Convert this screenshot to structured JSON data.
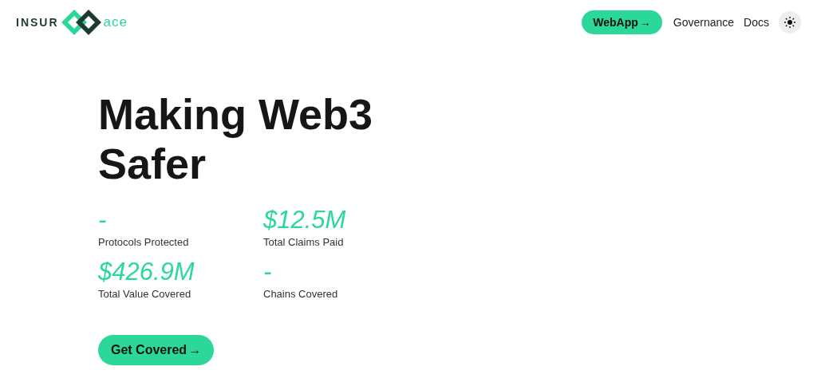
{
  "header": {
    "logo": {
      "left": "INSUR",
      "right": "ace"
    },
    "nav": [
      {
        "kind": "button",
        "label": "WebApp",
        "arrow": "→"
      },
      {
        "kind": "link",
        "label": "Governance"
      },
      {
        "kind": "link",
        "label": "Docs"
      },
      {
        "kind": "theme"
      }
    ]
  },
  "hero": {
    "title_lines": [
      "Making Web3",
      "Safer"
    ],
    "stats": [
      {
        "value": "-",
        "label": "Protocols Protected"
      },
      {
        "value": "$12.5M",
        "label": "Total Claims Paid"
      },
      {
        "value": "$426.9M",
        "label": "Total Value Covered"
      },
      {
        "value": "-",
        "label": "Chains Covered"
      }
    ],
    "cta": {
      "label": "Get Covered",
      "arrow": "→"
    }
  }
}
